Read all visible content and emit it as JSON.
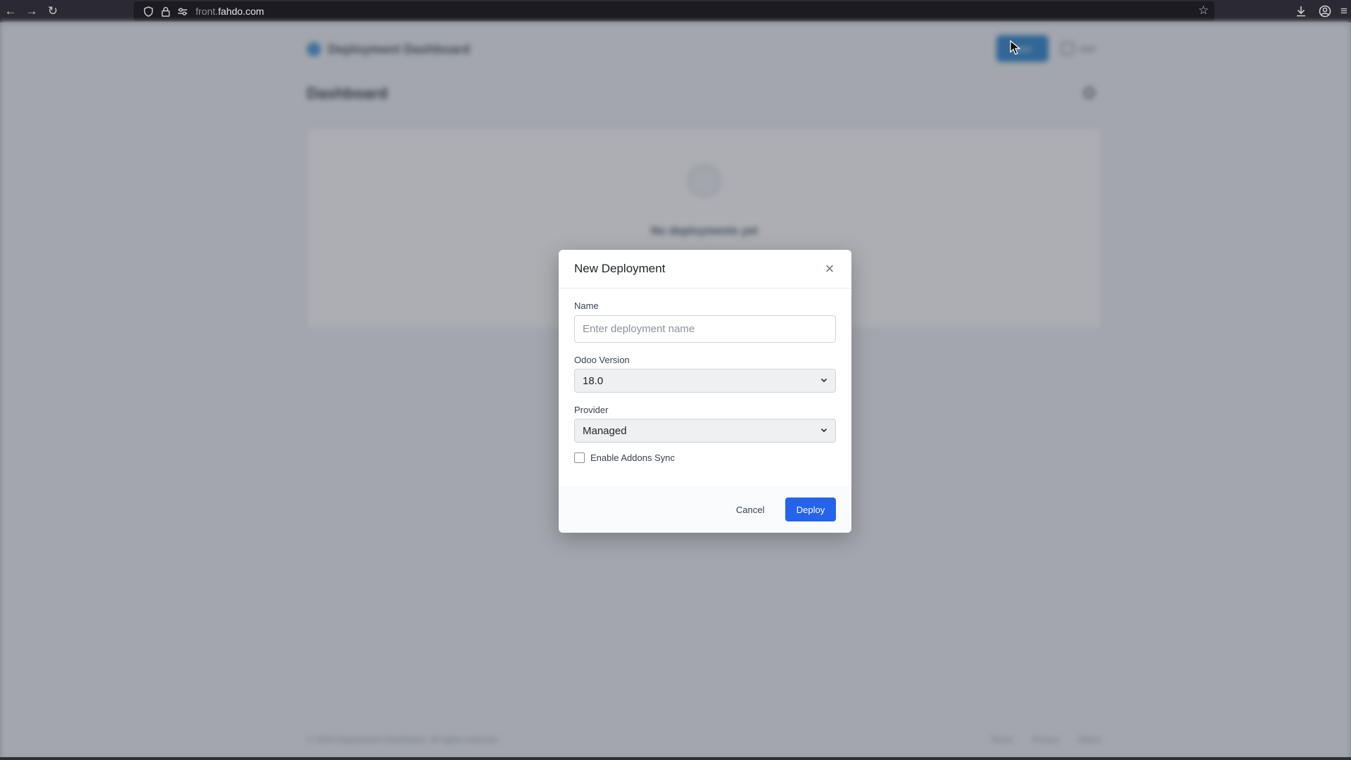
{
  "browser": {
    "url_prefix": "front.",
    "url_domain": "fahdo.com",
    "icons": [
      "back-icon",
      "forward-icon",
      "reload-icon",
      "shield-icon",
      "lock-icon",
      "site-settings-icon",
      "bookmark-star-icon",
      "download-icon",
      "account-icon",
      "extensions-icon"
    ]
  },
  "background": {
    "app_title": "Deployment Dashboard",
    "new_button_label": "New",
    "user_label": "user",
    "page_title": "Dashboard",
    "empty_state": "No deployments yet",
    "footer_copyright": "© 2025 Deployment Dashboard. All rights reserved.",
    "footer_links": [
      "Terms",
      "Privacy",
      "Status"
    ]
  },
  "modal": {
    "title": "New Deployment",
    "name_label": "Name",
    "name_placeholder": "Enter deployment name",
    "name_value": "",
    "version_label": "Odoo Version",
    "version_value": "18.0",
    "provider_label": "Provider",
    "provider_value": "Managed",
    "addons_label": "Enable Addons Sync",
    "addons_checked": false,
    "cancel_label": "Cancel",
    "deploy_label": "Deploy"
  },
  "colors": {
    "primary": "#2563eb",
    "browser_chrome": "#2b2a33"
  }
}
